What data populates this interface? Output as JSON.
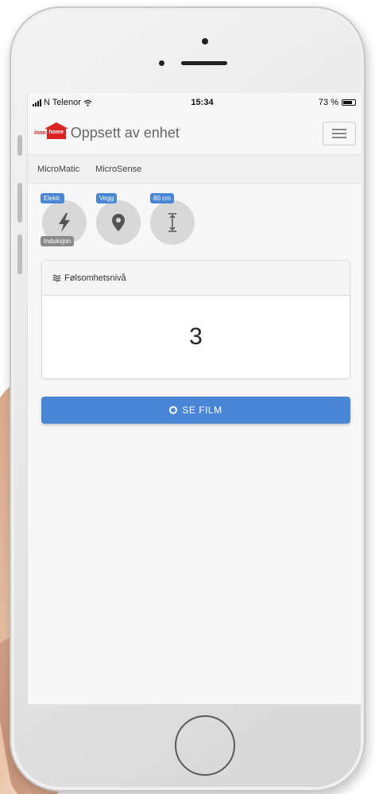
{
  "status_bar": {
    "carrier": "N Telenor",
    "time": "15:34",
    "battery": "73 %"
  },
  "navbar": {
    "logo_left": "inno",
    "logo_right": "home",
    "title": "Oppsett av enhet"
  },
  "tabs": [
    "MicroMatic",
    "MicroSense"
  ],
  "chips": [
    {
      "label": "Elektr.",
      "icon": "lightning-icon",
      "sub": "Induksjon"
    },
    {
      "label": "Vegg",
      "icon": "map-pin-icon"
    },
    {
      "label": "80 cm",
      "icon": "height-arrow-icon"
    }
  ],
  "panel": {
    "title": "Følsomhetsnivå",
    "value": "3"
  },
  "film_button": {
    "label": "SE FILM"
  },
  "colors": {
    "accent": "#4a86d6",
    "brand_red": "#d22222"
  }
}
